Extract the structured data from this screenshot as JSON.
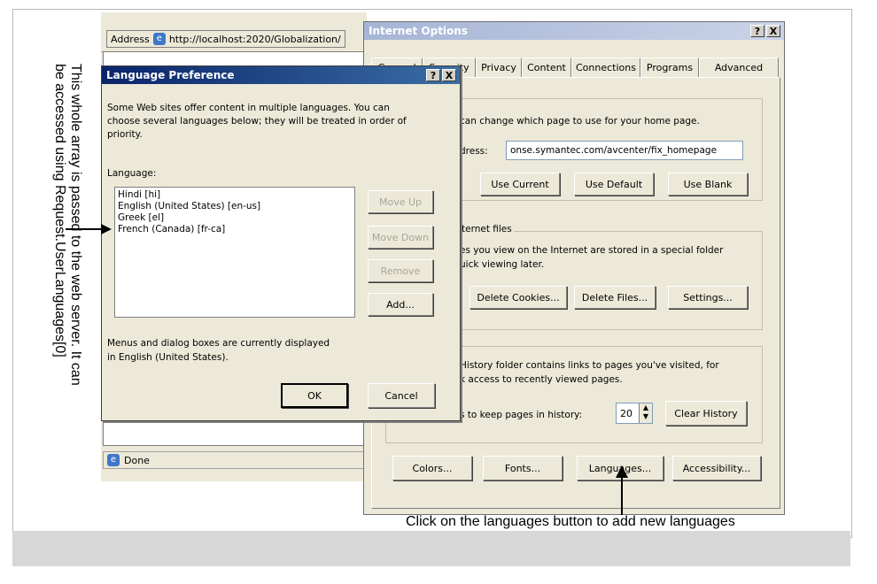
{
  "browser": {
    "address_label": "Address",
    "address_url": "http://localhost:2020/Globalization/",
    "status_text": "Done"
  },
  "internet_options": {
    "title": "Internet Options",
    "help_btn": "?",
    "close_btn": "X",
    "tabs": [
      "General",
      "Security",
      "Privacy",
      "Content",
      "Connections",
      "Programs",
      "Advanced"
    ],
    "home_text": "can change which page to use for your home page.",
    "address_label": "dress:",
    "home_url": "onse.symantec.com/avcenter/fix_homepage",
    "use_current": "Use Current",
    "use_default": "Use Default",
    "use_blank": "Use Blank",
    "temp_group": "ternet files",
    "temp_text1": "es you view on the Internet are stored in a special folder",
    "temp_text2": "uick viewing later.",
    "delete_cookies": "Delete Cookies...",
    "delete_files": "Delete Files...",
    "settings": "Settings...",
    "history_text1": "History folder contains links to pages you've visited, for",
    "history_text2": "k access to recently viewed pages.",
    "history_days_label": "s to keep pages in history:",
    "history_days": "20",
    "clear_history": "Clear History",
    "colors": "Colors...",
    "fonts": "Fonts...",
    "languages": "Languages...",
    "accessibility": "Accessibility..."
  },
  "lang_dialog": {
    "title": "Language Preference",
    "help_btn": "?",
    "close_btn": "X",
    "intro": [
      "Some Web sites offer content in multiple languages. You can",
      "choose several languages below; they will be treated in order of",
      "priority."
    ],
    "language_label": "Language:",
    "languages": [
      "Hindi [hi]",
      "English (United States) [en-us]",
      "Greek [el]",
      "French (Canada) [fr-ca]"
    ],
    "move_up": "Move Up",
    "move_down": "Move Down",
    "remove": "Remove",
    "add": "Add...",
    "footer": [
      "Menus and dialog boxes are currently displayed",
      "in English (United States)."
    ],
    "ok": "OK",
    "cancel": "Cancel"
  },
  "annotations": {
    "side_note_line1": "This whole array is passed to the web server. It can",
    "side_note_line2": "be accessed using Request.UserLanguages[0]",
    "bottom_note": "Click on the languages button to add new languages"
  },
  "colors": {
    "title_active": "#0a246a",
    "title_active2": "#3a6ea5",
    "title_inactive": "#7a96df",
    "dialog_bg": "#ece9d8"
  }
}
